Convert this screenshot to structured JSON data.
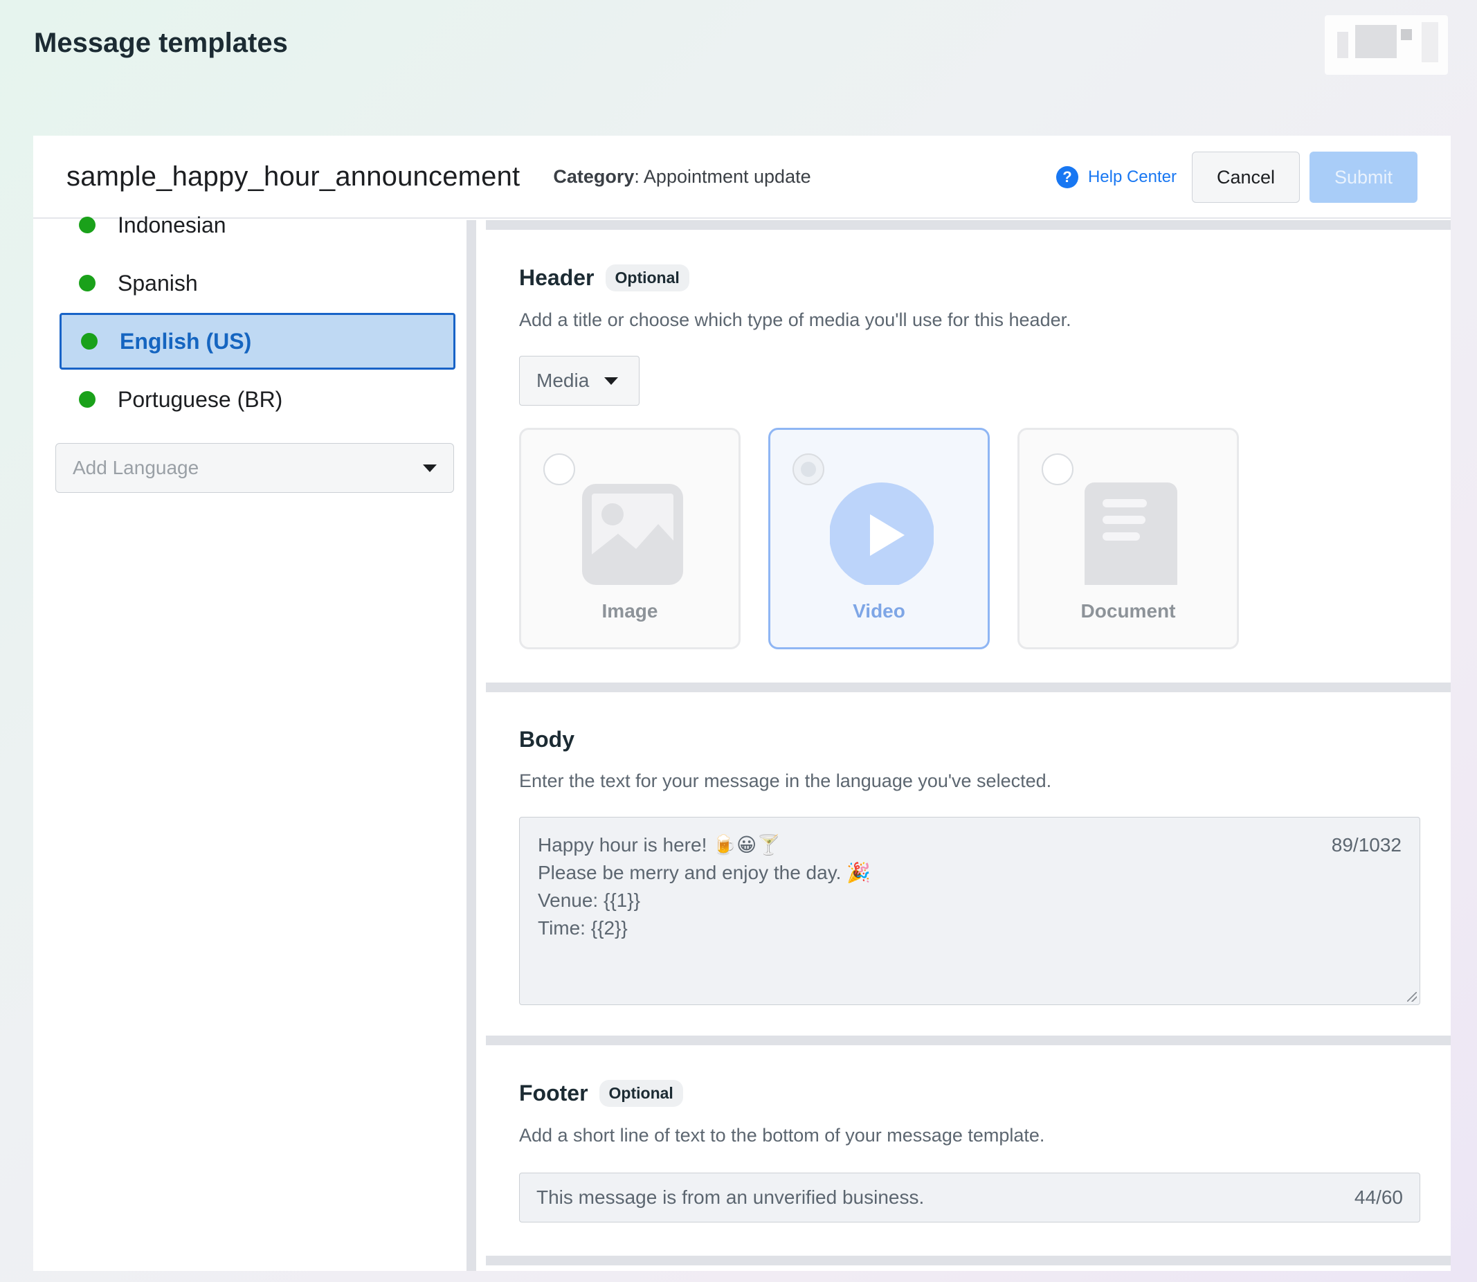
{
  "page": {
    "title": "Message templates"
  },
  "template": {
    "name": "sample_happy_hour_announcement",
    "category_label": "Category",
    "category_value": ": Appointment update"
  },
  "actions": {
    "help": "Help Center",
    "cancel": "Cancel",
    "submit": "Submit"
  },
  "languages": {
    "items": [
      {
        "label": "Indonesian",
        "status": "green"
      },
      {
        "label": "Spanish",
        "status": "green"
      },
      {
        "label": "English (US)",
        "status": "green",
        "active": true
      },
      {
        "label": "Portuguese (BR)",
        "status": "green"
      }
    ],
    "add_placeholder": "Add Language"
  },
  "header_section": {
    "title": "Header",
    "badge": "Optional",
    "description": "Add a title or choose which type of media you'll use for this header.",
    "select_value": "Media",
    "media_options": [
      {
        "label": "Image",
        "icon": "image-icon",
        "selected": false
      },
      {
        "label": "Video",
        "icon": "video-play-icon",
        "selected": true
      },
      {
        "label": "Document",
        "icon": "document-icon",
        "selected": false
      }
    ]
  },
  "body_section": {
    "title": "Body",
    "description": "Enter the text for your message in the language you've selected.",
    "lines": [
      "Happy hour is here! 🍺😀🍸",
      "Please be merry and enjoy the day. 🎉",
      "Venue: {{1}}",
      "Time: {{2}}"
    ],
    "counter": "89/1032"
  },
  "footer_section": {
    "title": "Footer",
    "badge": "Optional",
    "description": "Add a short line of text to the bottom of your message template.",
    "value": "This message is from an unverified business.",
    "counter": "44/60"
  },
  "colors": {
    "accent": "#1877f2",
    "status_green": "#1aa11a",
    "active_bg": "#bfd9f3"
  }
}
